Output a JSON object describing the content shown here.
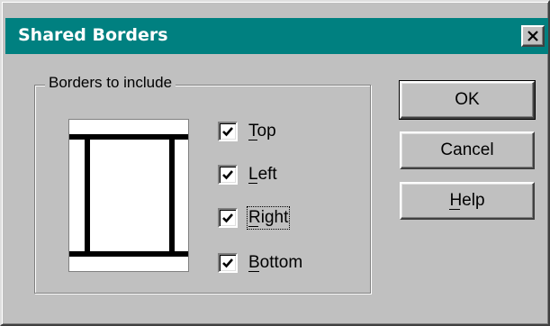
{
  "window": {
    "title": "Shared Borders",
    "close_icon": "close-x-icon"
  },
  "group": {
    "label": "Borders to include",
    "preview_icon": "page-border-preview-icon"
  },
  "checkboxes": [
    {
      "label": "Top",
      "mnemonic": "T",
      "checked": true
    },
    {
      "label": "Left",
      "mnemonic": "L",
      "checked": true
    },
    {
      "label": "Right",
      "mnemonic": "R",
      "checked": true,
      "focused": true
    },
    {
      "label": "Bottom",
      "mnemonic": "B",
      "checked": true
    }
  ],
  "buttons": {
    "ok": "OK",
    "cancel": "Cancel",
    "help": "Help",
    "help_mnemonic": "H"
  },
  "colors": {
    "titlebar": "#008080",
    "face": "#c0c0c0"
  }
}
